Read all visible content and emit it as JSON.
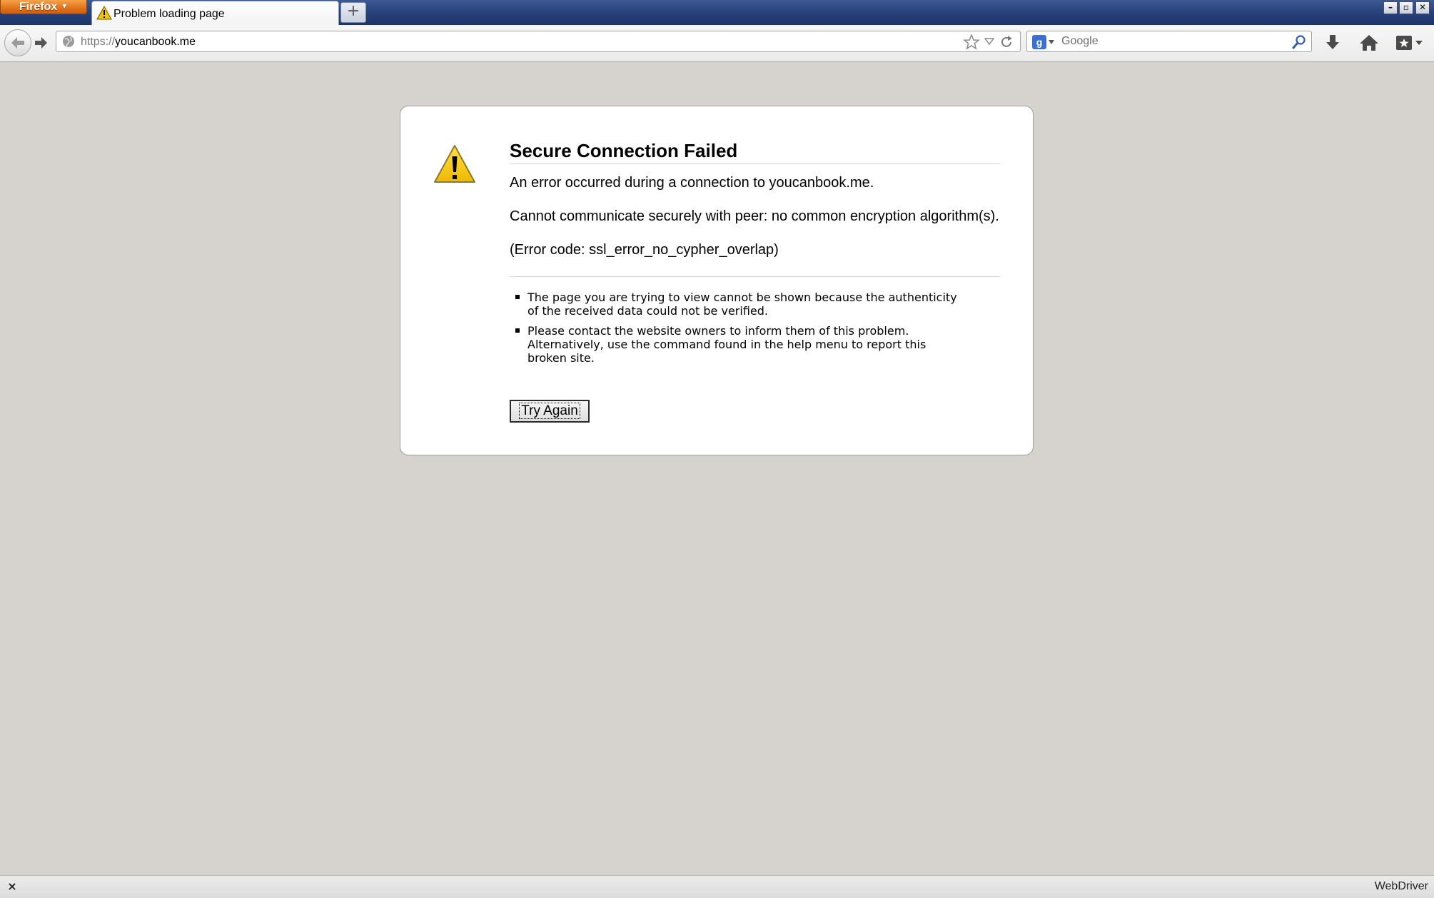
{
  "browser": {
    "menu_button_label": "Firefox",
    "tab_title": "Problem loading page",
    "newtab_label": "+",
    "window_controls": {
      "minimize": "–",
      "maximize": "▫",
      "close": "✕"
    }
  },
  "navbar": {
    "url_scheme": "https://",
    "url_host": "youcanbook.me",
    "search_placeholder": "Google"
  },
  "icons": {
    "tab": "warning-icon",
    "back": "back-arrow-icon",
    "forward": "forward-arrow-icon",
    "site": "globe-icon",
    "bookmark": "star-icon",
    "history": "chevron-down-icon",
    "reload": "reload-icon",
    "search_engine": "google-icon",
    "search_go": "magnifier-icon",
    "downloads": "download-arrow-icon",
    "home": "home-icon",
    "bookmarks_menu": "bookmarks-icon"
  },
  "error": {
    "title": "Secure Connection Failed",
    "line1": "An error occurred during a connection to youcanbook.me.",
    "line2": "Cannot communicate securely with peer: no common encryption algorithm(s).",
    "line3": "(Error code: ssl_error_no_cypher_overlap)",
    "bullets": [
      "The page you are trying to view cannot be shown because the authenticity of the received data could not be verified.",
      "Please contact the website owners to inform them of this problem. Alternatively, use the command found in the help menu to report this broken site."
    ],
    "try_again_label": "Try Again"
  },
  "statusbar": {
    "close_glyph": "×",
    "right_text": "WebDriver"
  },
  "colors": {
    "page_background": "#d6d3ce",
    "firefox_button": "#e2731a",
    "titlebar": "#264079",
    "warning_yellow": "#f5c400"
  }
}
